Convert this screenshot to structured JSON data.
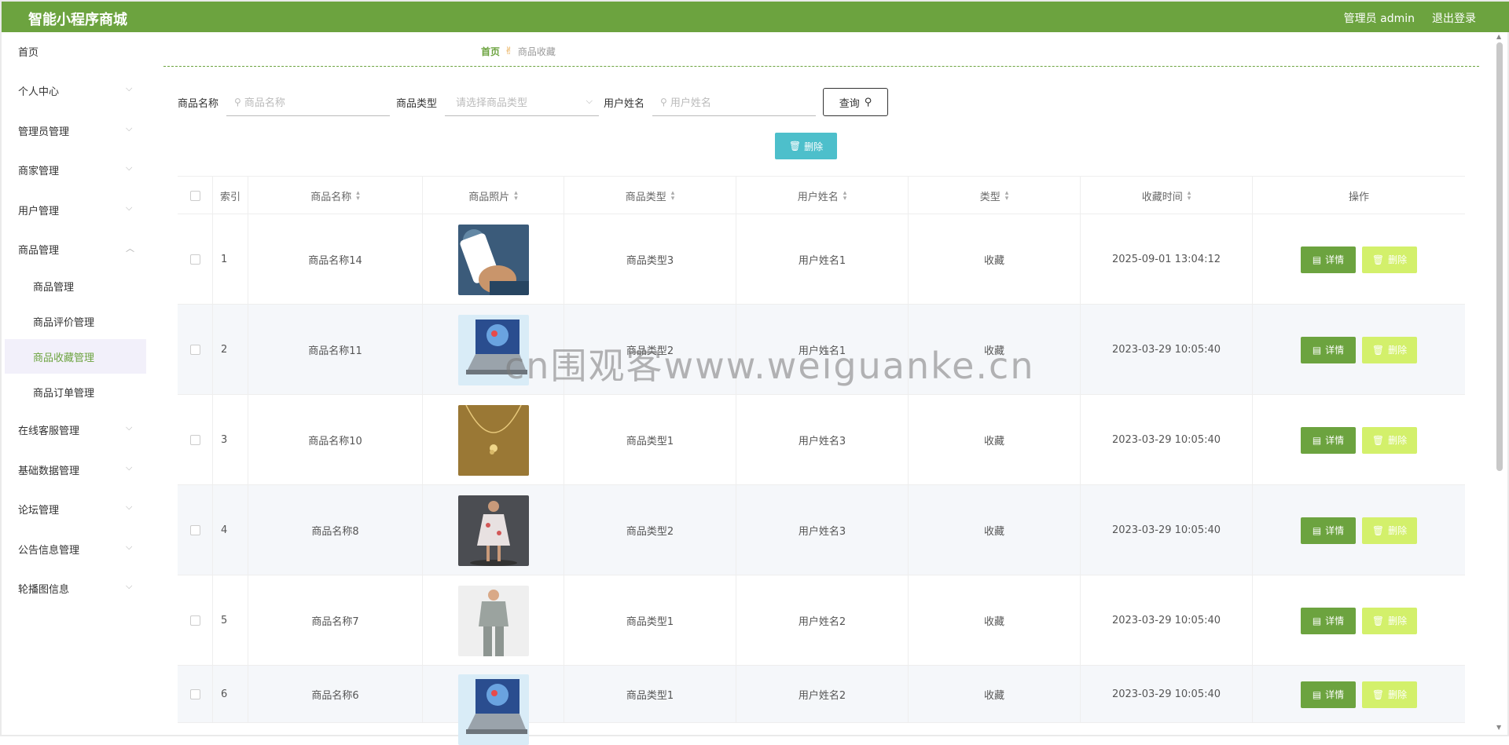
{
  "header": {
    "brand": "智能小程序商城",
    "admin": "管理员 admin",
    "logout": "退出登录",
    "bg_color": "#6ca33f"
  },
  "sidebar": {
    "items": [
      {
        "label": "首页"
      },
      {
        "label": "个人中心"
      },
      {
        "label": "管理员管理"
      },
      {
        "label": "商家管理"
      },
      {
        "label": "用户管理"
      },
      {
        "label": "商品管理"
      },
      {
        "label": "在线客服管理"
      },
      {
        "label": "基础数据管理"
      },
      {
        "label": "论坛管理"
      },
      {
        "label": "公告信息管理"
      },
      {
        "label": "轮播图信息"
      }
    ],
    "subitems": [
      {
        "label": "商品管理"
      },
      {
        "label": "商品评价管理"
      },
      {
        "label": "商品收藏管理",
        "active": true
      },
      {
        "label": "商品订单管理"
      }
    ]
  },
  "breadcrumb": {
    "home": "首页",
    "current": "商品收藏"
  },
  "search": {
    "name_label": "商品名称",
    "name_placeholder": "商品名称",
    "type_label": "商品类型",
    "type_placeholder": "请选择商品类型",
    "user_label": "用户姓名",
    "user_placeholder": "用户姓名",
    "query_button": "查询"
  },
  "batch_delete": "删除",
  "table": {
    "headers": [
      "索引",
      "商品名称",
      "商品照片",
      "商品类型",
      "用户姓名",
      "类型",
      "收藏时间",
      "操作"
    ],
    "rows": [
      {
        "index": "1",
        "name": "商品名称14",
        "type": "商品类型3",
        "user": "用户姓名1",
        "kind": "收藏",
        "time": "2025-09-01 13:04:12",
        "photo": "phone-in-hand"
      },
      {
        "index": "2",
        "name": "商品名称11",
        "type": "商品类型2",
        "user": "用户姓名1",
        "kind": "收藏",
        "time": "2023-03-29 10:05:40",
        "photo": "laptop"
      },
      {
        "index": "3",
        "name": "商品名称10",
        "type": "商品类型1",
        "user": "用户姓名3",
        "kind": "收藏",
        "time": "2023-03-29 10:05:40",
        "photo": "necklace"
      },
      {
        "index": "4",
        "name": "商品名称8",
        "type": "商品类型2",
        "user": "用户姓名3",
        "kind": "收藏",
        "time": "2023-03-29 10:05:40",
        "photo": "dress-model"
      },
      {
        "index": "5",
        "name": "商品名称7",
        "type": "商品类型1",
        "user": "用户姓名2",
        "kind": "收藏",
        "time": "2023-03-29 10:05:40",
        "photo": "suit-model"
      },
      {
        "index": "6",
        "name": "商品名称6",
        "type": "商品类型1",
        "user": "用户姓名2",
        "kind": "收藏",
        "time": "2023-03-29 10:05:40",
        "photo": "laptop"
      }
    ],
    "detail_button": "详情",
    "delete_button": "删除"
  },
  "watermark": "cn围观客www.weiguanke.cn"
}
